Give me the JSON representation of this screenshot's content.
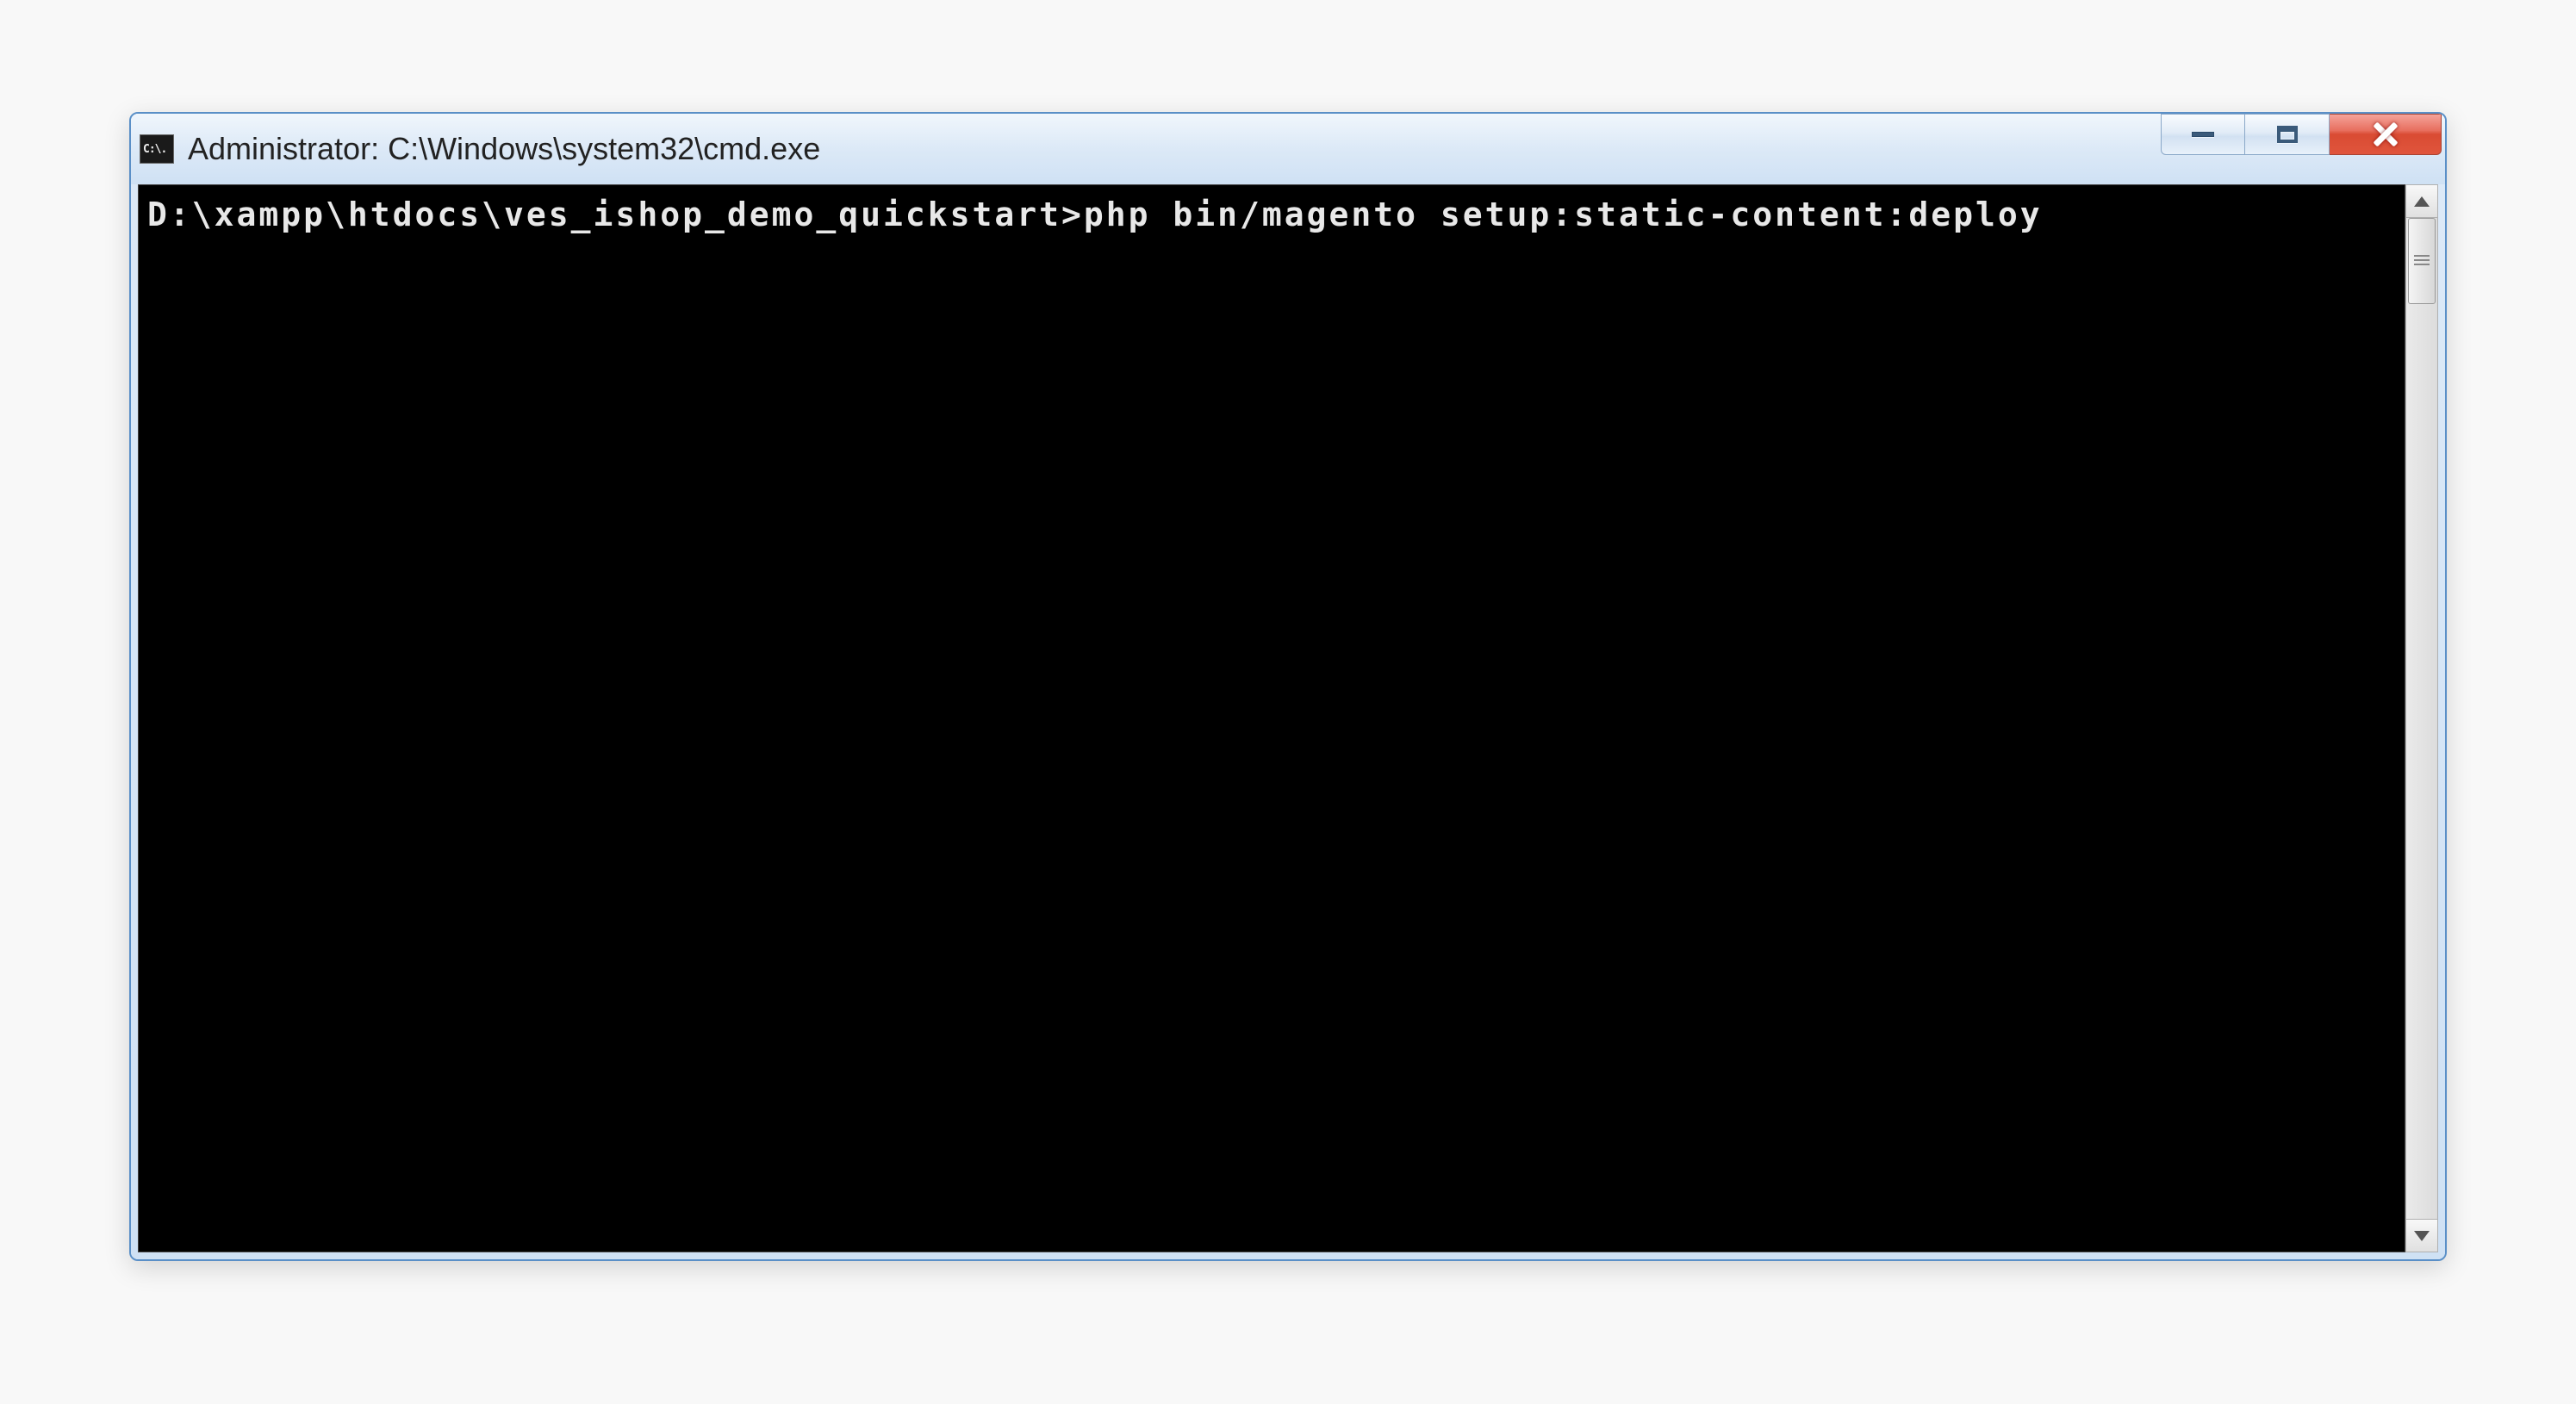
{
  "window": {
    "icon_text": "C:\\.",
    "title": "Administrator: C:\\Windows\\system32\\cmd.exe"
  },
  "terminal": {
    "content": "D:\\xampp\\htdocs\\ves_ishop_demo_quickstart>php bin/magento setup:static-content:deploy"
  }
}
